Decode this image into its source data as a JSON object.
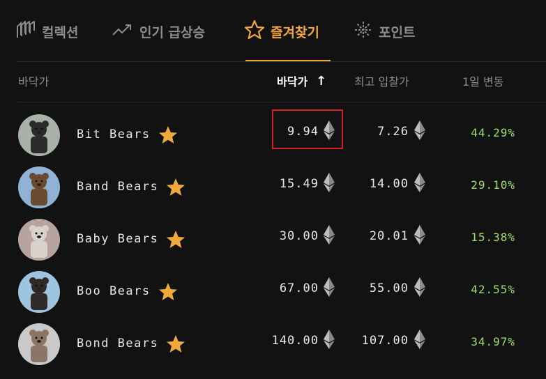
{
  "tabs": [
    {
      "label": "컬렉션",
      "icon": "collection-icon"
    },
    {
      "label": "인기 급상승",
      "icon": "trending-icon"
    },
    {
      "label": "즐겨찾기",
      "icon": "star-icon",
      "active": true
    },
    {
      "label": "포인트",
      "icon": "sparkle-icon"
    }
  ],
  "headers": {
    "name": "바닥가",
    "floor": "바닥가",
    "sort_arrow": "↑",
    "top_bid": "최고 입찰가",
    "change": "1일 변동"
  },
  "rows": [
    {
      "name": "Bit Bears",
      "floor": "9.94",
      "top_bid": "7.26",
      "change": "44.29%",
      "avatar": "bear-avatar"
    },
    {
      "name": "Band Bears",
      "floor": "15.49",
      "top_bid": "14.00",
      "change": "29.10%",
      "avatar": "bear-avatar"
    },
    {
      "name": "Baby Bears",
      "floor": "30.00",
      "top_bid": "20.01",
      "change": "15.38%",
      "avatar": "bear-avatar"
    },
    {
      "name": "Boo Bears",
      "floor": "67.00",
      "top_bid": "55.00",
      "change": "42.55%",
      "avatar": "bear-avatar"
    },
    {
      "name": "Bond Bears",
      "floor": "140.00",
      "top_bid": "107.00",
      "change": "34.97%",
      "avatar": "bear-avatar"
    }
  ],
  "colors": {
    "accent": "#f2a93b",
    "positive": "#9fe06b",
    "highlight": "#d61f1f",
    "background": "#131212"
  }
}
